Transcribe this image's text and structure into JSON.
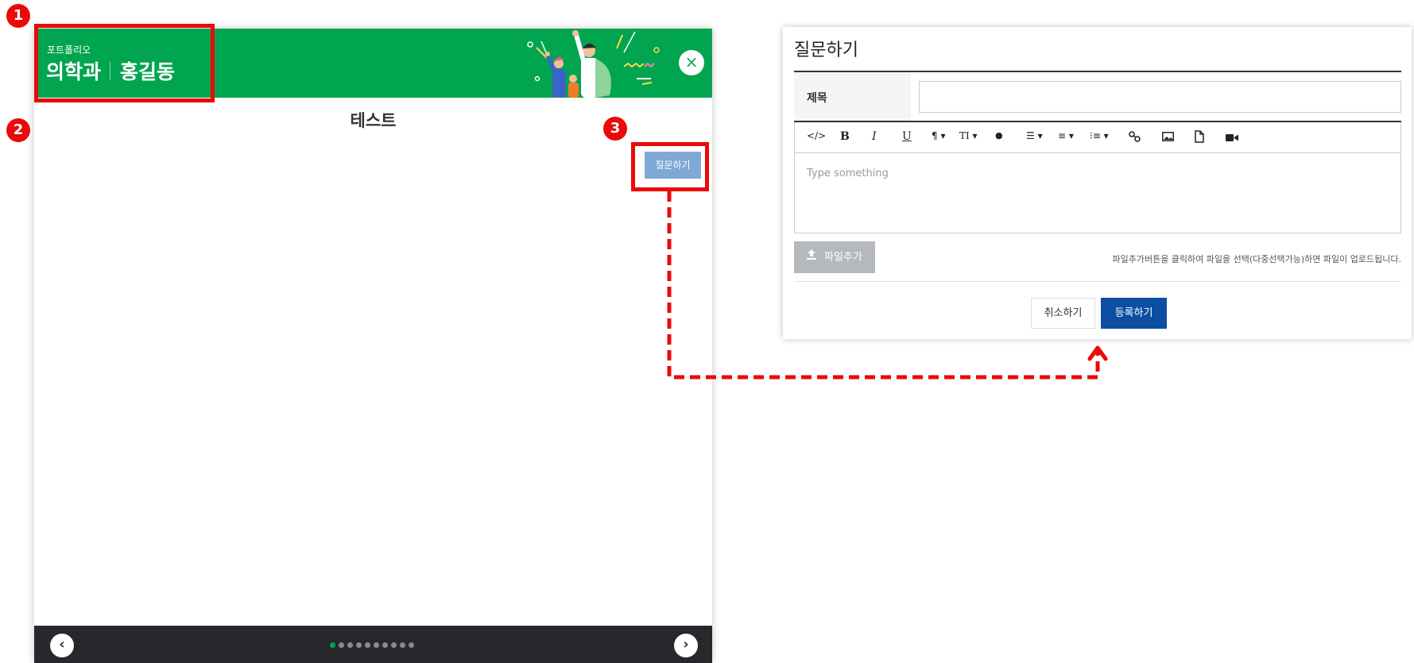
{
  "viewer": {
    "header": {
      "kicker": "포트폴리오",
      "department": "의학과",
      "student_name": "홍길동",
      "close_glyph": "×"
    },
    "content_title": "테스트",
    "ask_button_label": "질문하기",
    "footer": {
      "prev_glyph": "‹",
      "next_glyph": "›",
      "page_count": 10,
      "current_page": 1
    },
    "colors": {
      "header_green": "#02a54f",
      "footer_dark": "#26282b",
      "ask_button": "#7ea9d6"
    }
  },
  "annotations": {
    "markers": [
      "1",
      "2",
      "3"
    ],
    "color": "#ea0a0a"
  },
  "dialog": {
    "title": "질문하기",
    "subject_label": "제목",
    "subject_value": "",
    "toolbar": {
      "code": "</>",
      "bold": "B",
      "italic": "I",
      "underline": "U",
      "paragraph": "¶ ▾",
      "text_size": "TI ▾",
      "color": "●",
      "align": "☰ ▾",
      "ordered_list": "≡ ▾",
      "unordered_list": "⁝≡ ▾",
      "link": "link-icon",
      "image": "image-icon",
      "file": "file-icon",
      "video": "video-icon"
    },
    "editor_placeholder": "Type something",
    "file_button_label": "파일추가",
    "file_hint": "파일추가버튼을 클릭하여 파일을 선택(다중선택가능)하면 파일이 업로드됩니다.",
    "cancel_label": "취소하기",
    "submit_label": "등록하기",
    "colors": {
      "submit": "#0b4ea2",
      "file_button": "#b5b8bd"
    }
  }
}
